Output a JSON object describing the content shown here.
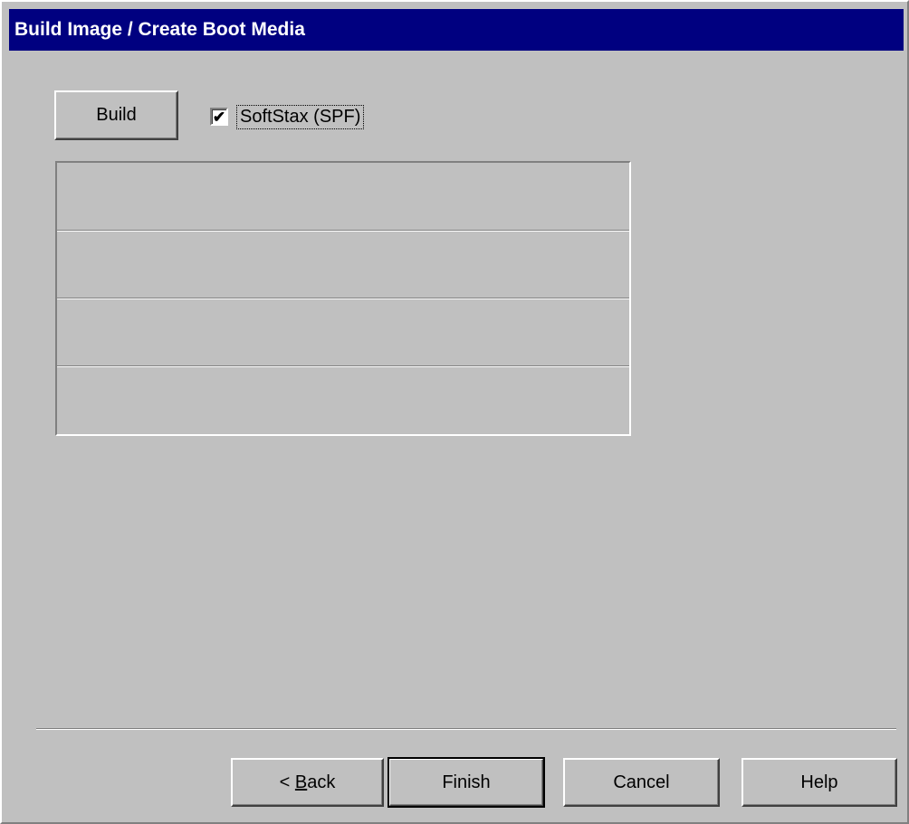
{
  "window": {
    "title": "Build Image / Create Boot Media"
  },
  "toolbar": {
    "build_label": "Build",
    "softstax_checkbox": {
      "label": "SoftStax (SPF)",
      "checked": true
    }
  },
  "list_rows": [
    "",
    "",
    "",
    ""
  ],
  "footer": {
    "back_prefix": "< ",
    "back_accel": "B",
    "back_rest": "ack",
    "finish_label": "Finish",
    "cancel_label": "Cancel",
    "help_label": "Help"
  },
  "colors": {
    "title_bar": "#000080",
    "face": "#c0c0c0"
  }
}
